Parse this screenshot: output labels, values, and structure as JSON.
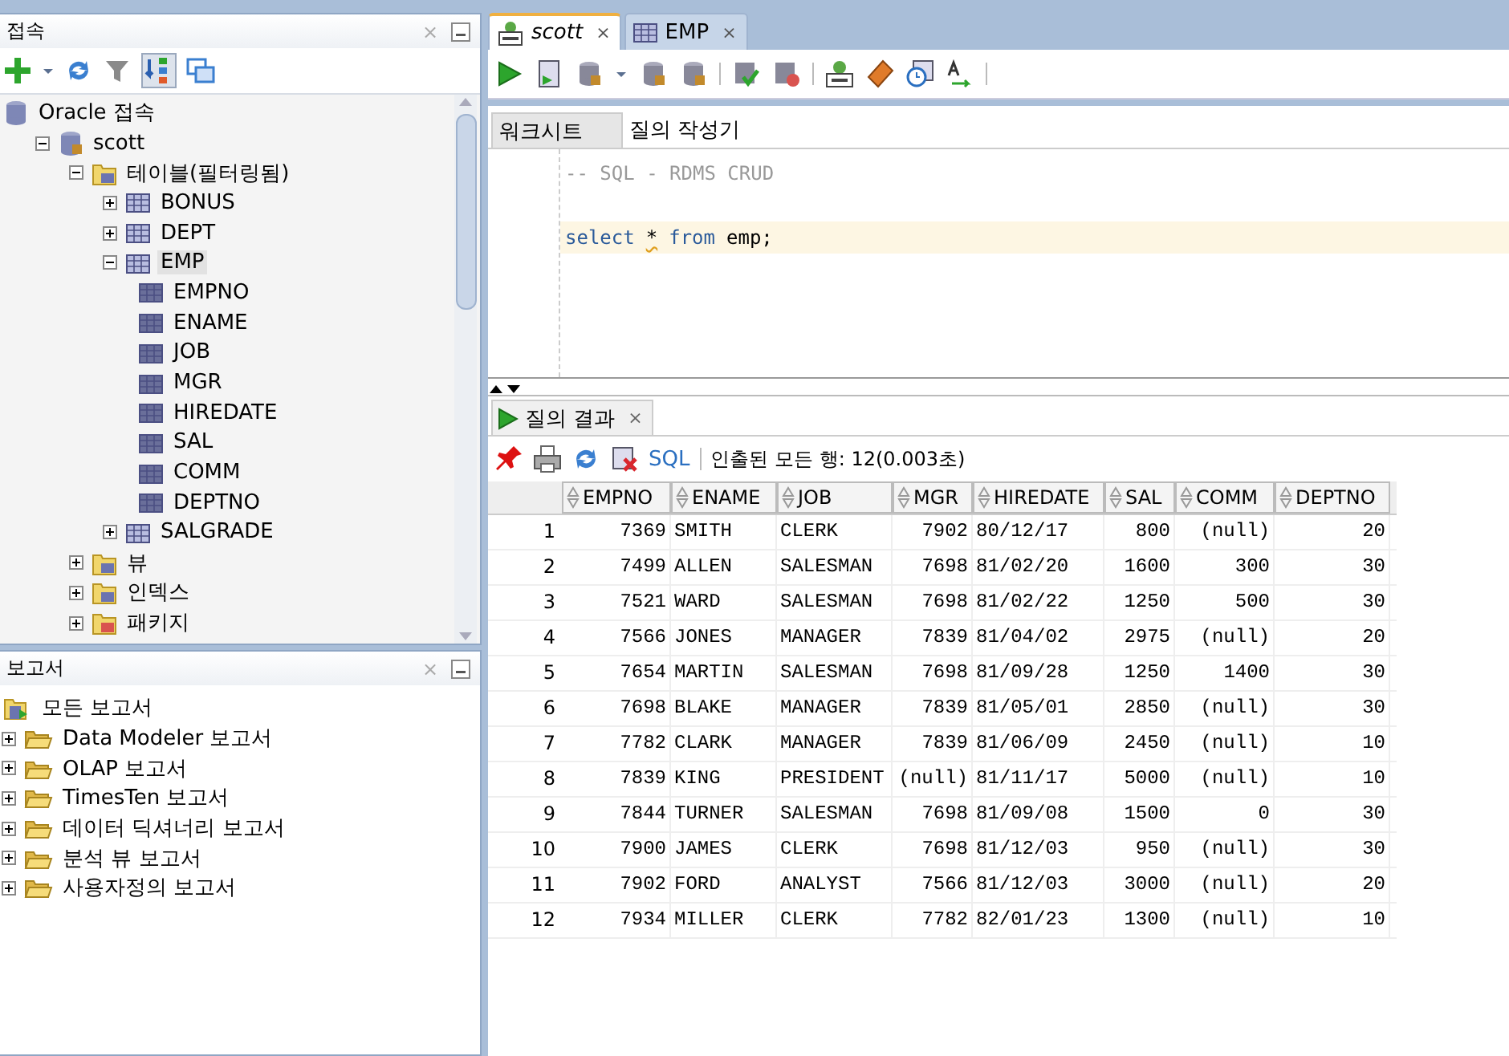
{
  "connections_panel": {
    "title": "접속",
    "close": "×",
    "tree": [
      {
        "label": "Oracle 접속",
        "kind": "db",
        "children": [
          {
            "label": "scott",
            "kind": "connection",
            "expanded": true,
            "children": [
              {
                "label": "테이블(필터링됨)",
                "kind": "table-folder",
                "expanded": true,
                "children": [
                  {
                    "label": "BONUS",
                    "kind": "table",
                    "expanded": false,
                    "selected": false
                  },
                  {
                    "label": "DEPT",
                    "kind": "table",
                    "expanded": false,
                    "selected": false
                  },
                  {
                    "label": "EMP",
                    "kind": "table",
                    "expanded": true,
                    "selected": true,
                    "children": [
                      {
                        "label": "EMPNO",
                        "kind": "column"
                      },
                      {
                        "label": "ENAME",
                        "kind": "column"
                      },
                      {
                        "label": "JOB",
                        "kind": "column"
                      },
                      {
                        "label": "MGR",
                        "kind": "column"
                      },
                      {
                        "label": "HIREDATE",
                        "kind": "column"
                      },
                      {
                        "label": "SAL",
                        "kind": "column"
                      },
                      {
                        "label": "COMM",
                        "kind": "column"
                      },
                      {
                        "label": "DEPTNO",
                        "kind": "column"
                      }
                    ]
                  },
                  {
                    "label": "SALGRADE",
                    "kind": "table",
                    "expanded": false,
                    "selected": false
                  }
                ]
              },
              {
                "label": "뷰",
                "kind": "view-folder",
                "expanded": false
              },
              {
                "label": "인덱스",
                "kind": "index-folder",
                "expanded": false
              },
              {
                "label": "패키지",
                "kind": "package-folder",
                "expanded": false
              }
            ]
          }
        ]
      }
    ]
  },
  "reports_panel": {
    "title": "보고서",
    "close": "×",
    "tree": [
      {
        "label": "모든 보고서",
        "kind": "reports",
        "children": [
          {
            "label": "Data Modeler 보고서",
            "kind": "report-folder",
            "expanded": false
          },
          {
            "label": "OLAP 보고서",
            "kind": "report-folder",
            "expanded": false
          },
          {
            "label": "TimesTen 보고서",
            "kind": "report-folder",
            "expanded": false
          },
          {
            "label": "데이터 딕셔너리 보고서",
            "kind": "report-folder",
            "expanded": false
          },
          {
            "label": "분석 뷰 보고서",
            "kind": "report-folder",
            "expanded": false
          },
          {
            "label": "사용자정의 보고서",
            "kind": "report-folder",
            "expanded": false
          }
        ]
      }
    ]
  },
  "editor_tabs": [
    {
      "label": "scott",
      "kind": "sql",
      "selected": true,
      "close": "×"
    },
    {
      "label": "EMP",
      "kind": "table",
      "selected": false,
      "close": "×"
    }
  ],
  "worksheet_tabs": [
    {
      "label": "워크시트",
      "selected": true
    },
    {
      "label": "질의 작성기",
      "selected": false
    }
  ],
  "editor_lines": [
    {
      "kind": "comment",
      "text": "-- SQL - RDMS CRUD"
    },
    {
      "kind": "blank"
    },
    {
      "kind": "code",
      "current": true,
      "tokens": [
        {
          "kind": "keyword",
          "text": "select"
        },
        {
          "kind": "warning",
          "text": "*"
        },
        {
          "kind": "keyword",
          "text": "from"
        },
        {
          "kind": "plain",
          "text": "emp;"
        }
      ]
    }
  ],
  "results": {
    "tab": {
      "label": "질의 결과",
      "close": "×"
    },
    "sql_link": "SQL",
    "status": "인출된 모든 행: 12(0.003초)",
    "columns": [
      {
        "label": "EMPNO",
        "kind": "number"
      },
      {
        "label": "ENAME",
        "kind": "text"
      },
      {
        "label": "JOB",
        "kind": "text"
      },
      {
        "label": "MGR",
        "kind": "number"
      },
      {
        "label": "HIREDATE",
        "kind": "text"
      },
      {
        "label": "SAL",
        "kind": "number"
      },
      {
        "label": "COMM",
        "kind": "number"
      },
      {
        "label": "DEPTNO",
        "kind": "number"
      }
    ],
    "rows": [
      {
        "number": "1",
        "cells": [
          "7369",
          "SMITH",
          "CLERK",
          "7902",
          "80/12/17",
          "800",
          "(null)",
          "20"
        ]
      },
      {
        "number": "2",
        "cells": [
          "7499",
          "ALLEN",
          "SALESMAN",
          "7698",
          "81/02/20",
          "1600",
          "300",
          "30"
        ]
      },
      {
        "number": "3",
        "cells": [
          "7521",
          "WARD",
          "SALESMAN",
          "7698",
          "81/02/22",
          "1250",
          "500",
          "30"
        ]
      },
      {
        "number": "4",
        "cells": [
          "7566",
          "JONES",
          "MANAGER",
          "7839",
          "81/04/02",
          "2975",
          "(null)",
          "20"
        ]
      },
      {
        "number": "5",
        "cells": [
          "7654",
          "MARTIN",
          "SALESMAN",
          "7698",
          "81/09/28",
          "1250",
          "1400",
          "30"
        ]
      },
      {
        "number": "6",
        "cells": [
          "7698",
          "BLAKE",
          "MANAGER",
          "7839",
          "81/05/01",
          "2850",
          "(null)",
          "30"
        ]
      },
      {
        "number": "7",
        "cells": [
          "7782",
          "CLARK",
          "MANAGER",
          "7839",
          "81/06/09",
          "2450",
          "(null)",
          "10"
        ]
      },
      {
        "number": "8",
        "cells": [
          "7839",
          "KING",
          "PRESIDENT",
          "(null)",
          "81/11/17",
          "5000",
          "(null)",
          "10"
        ]
      },
      {
        "number": "9",
        "cells": [
          "7844",
          "TURNER",
          "SALESMAN",
          "7698",
          "81/09/08",
          "1500",
          "0",
          "30"
        ]
      },
      {
        "number": "10",
        "cells": [
          "7900",
          "JAMES",
          "CLERK",
          "7698",
          "81/12/03",
          "950",
          "(null)",
          "30"
        ]
      },
      {
        "number": "11",
        "cells": [
          "7902",
          "FORD",
          "ANALYST",
          "7566",
          "81/12/03",
          "3000",
          "(null)",
          "20"
        ]
      },
      {
        "number": "12",
        "cells": [
          "7934",
          "MILLER",
          "CLERK",
          "7782",
          "82/01/23",
          "1300",
          "(null)",
          "10"
        ]
      }
    ]
  }
}
